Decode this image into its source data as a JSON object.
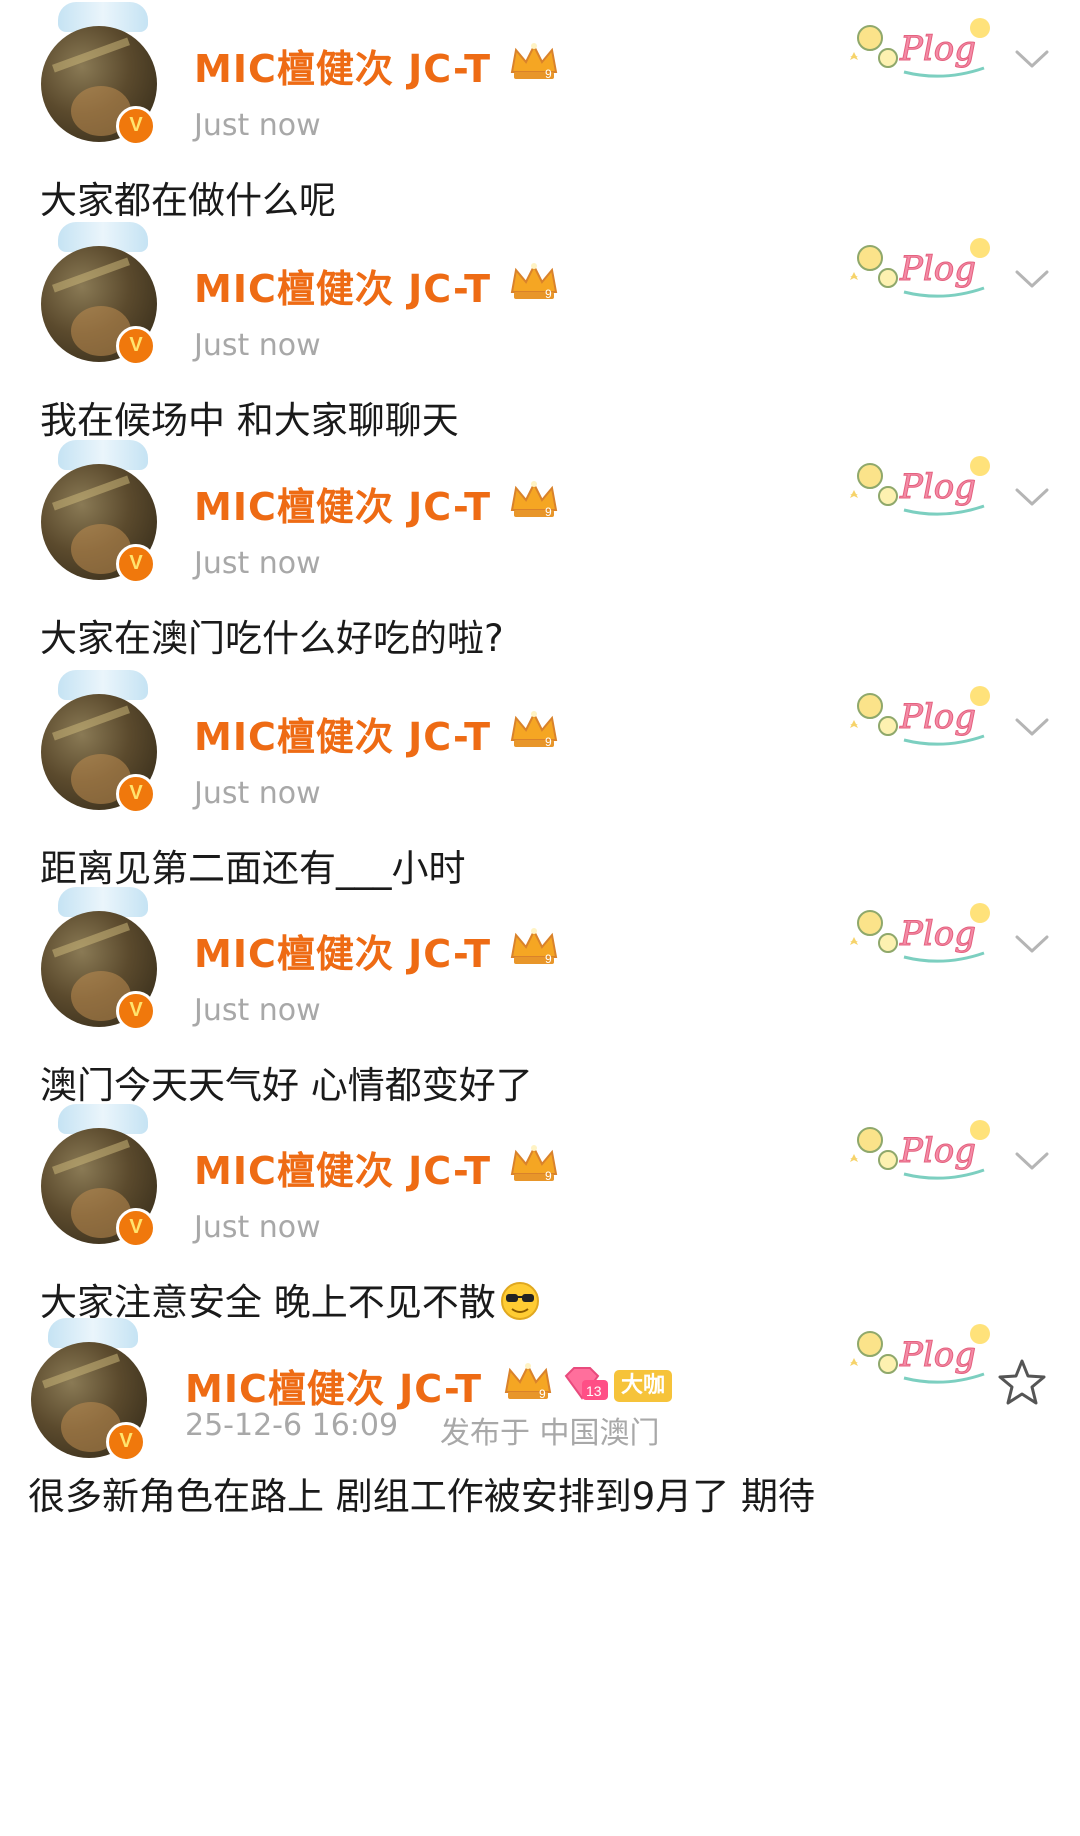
{
  "accent_color": "#ee6b14",
  "posts": [
    {
      "name": "MIC檀健次 JC-T",
      "time": "Just now",
      "text": "大家都在做什么呢",
      "sticker": "Plog"
    },
    {
      "name": "MIC檀健次 JC-T",
      "time": "Just now",
      "text": "我在候场中 和大家聊聊天",
      "sticker": "Plog"
    },
    {
      "name": "MIC檀健次 JC-T",
      "time": "Just now",
      "text": "大家在澳门吃什么好吃的啦?",
      "sticker": "Plog"
    },
    {
      "name": "MIC檀健次 JC-T",
      "time": "Just now",
      "text": "距离见第二面还有___小时",
      "sticker": "Plog"
    },
    {
      "name": "MIC檀健次 JC-T",
      "time": "Just now",
      "text": "澳门今天天气好 心情都变好了",
      "sticker": "Plog"
    },
    {
      "name": "MIC檀健次 JC-T",
      "time": "Just now",
      "text": "大家注意安全 晚上不见不散",
      "sticker": "Plog"
    }
  ],
  "final_post": {
    "name": "MIC檀健次 JC-T",
    "level_badge": "13",
    "tag": "大咖",
    "date": "25-12-6 16:09",
    "location": "发布于 中国澳门",
    "text": "很多新角色在路上 剧组工作被安排到9月了 期待",
    "sticker": "Plog"
  },
  "icons": {
    "avatar_badge": "V",
    "crown_level": "9",
    "emoji": "sunglasses-face",
    "collapse": "chevron-down-icon",
    "favorite": "star-icon"
  }
}
